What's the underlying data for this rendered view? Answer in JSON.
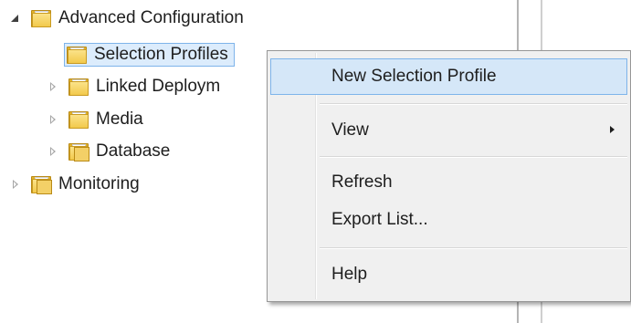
{
  "tree": {
    "items": [
      {
        "label": "Advanced Configuration",
        "icon": "folder-icon",
        "state": "expanded"
      },
      {
        "label": "Selection Profiles",
        "icon": "folder-icon",
        "state": "none",
        "selected": true
      },
      {
        "label": "Linked Deploym",
        "icon": "folder-icon",
        "state": "collapsed"
      },
      {
        "label": "Media",
        "icon": "folder-icon",
        "state": "collapsed"
      },
      {
        "label": "Database",
        "icon": "multi-folder-icon",
        "state": "collapsed"
      },
      {
        "label": "Monitoring",
        "icon": "multi-folder-icon",
        "state": "collapsed"
      }
    ]
  },
  "context_menu": {
    "items": [
      {
        "label": "New Selection Profile",
        "highlighted": true
      },
      {
        "label": "View",
        "has_submenu": true
      },
      {
        "label": "Refresh"
      },
      {
        "label": "Export List..."
      },
      {
        "label": "Help"
      }
    ]
  },
  "colors": {
    "selection_border": "#7eb4ea",
    "selection_fill": "#dcecfc",
    "menu_background": "#f0f0f0",
    "folder_yellow": "#f2c94c"
  }
}
